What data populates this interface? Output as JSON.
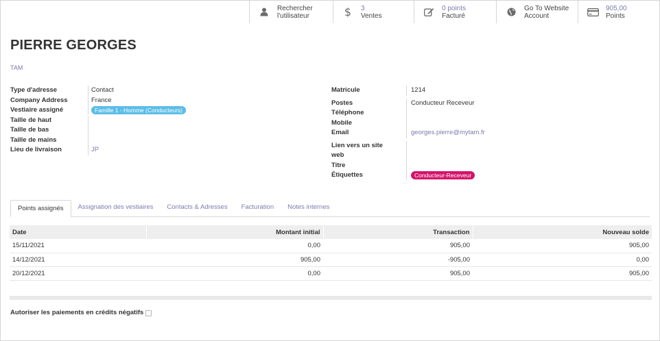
{
  "smart_buttons": [
    {
      "icon": "user-icon",
      "value": "",
      "line1": "Rechercher",
      "line2": "l'utilisateur"
    },
    {
      "icon": "dollar-icon",
      "value": "3",
      "line2": "Ventes"
    },
    {
      "icon": "edit-icon",
      "value": "0 points",
      "line2": "Facturé"
    },
    {
      "icon": "globe-icon",
      "value": "",
      "line1": "Go To Website",
      "line2": "Account"
    },
    {
      "icon": "card-icon",
      "value": "905,00",
      "line2": "Points"
    }
  ],
  "partner": {
    "name": "PIERRE GEORGES",
    "company": "TAM"
  },
  "left_fields": {
    "address_type_label": "Type d'adresse",
    "address_type_value": "Contact",
    "company_address_label": "Company Address",
    "company_address_value": "France",
    "vestiaire_label": "Vestiaire assigné",
    "vestiaire_value": "Famille 1 - Homme (Conducteurs)",
    "taille_haut_label": "Taille de haut",
    "taille_bas_label": "Taille de bas",
    "taille_mains_label": "Taille de mains",
    "livraison_label": "Lieu de livraison",
    "livraison_value": "JP"
  },
  "right_fields": {
    "matricule_label": "Matricule",
    "matricule_value": "1214",
    "postes_label": "Postes",
    "postes_value": "Conducteur Receveur",
    "telephone_label": "Téléphone",
    "mobile_label": "Mobile",
    "email_label": "Email",
    "email_value": "georges.pierre@mytam.fr",
    "website_label_1": "Lien vers un site",
    "website_label_2": "web",
    "titre_label": "Titre",
    "etiquettes_label": "Étiquettes",
    "etiquettes_value": "Conducteur-Receveur"
  },
  "tabs": [
    {
      "label": "Points assignés",
      "active": true
    },
    {
      "label": "Assignation des vestiaires",
      "active": false
    },
    {
      "label": "Contacts & Adresses",
      "active": false
    },
    {
      "label": "Facturation",
      "active": false
    },
    {
      "label": "Notes internes",
      "active": false
    }
  ],
  "table": {
    "headers": [
      "Date",
      "Montant initial",
      "Transaction",
      "Nouveau solde"
    ],
    "rows": [
      [
        "15/11/2021",
        "0,00",
        "905,00",
        "905,00"
      ],
      [
        "14/12/2021",
        "905,00",
        "-905,00",
        "0,00"
      ],
      [
        "20/12/2021",
        "0,00",
        "905,00",
        "905,00"
      ]
    ]
  },
  "negative_credits_label": "Autoriser les paiements en crédits négatifs",
  "colors": {
    "link": "#7c7bad",
    "pill_blue": "#5bbde7",
    "pill_red": "#d4146b"
  }
}
